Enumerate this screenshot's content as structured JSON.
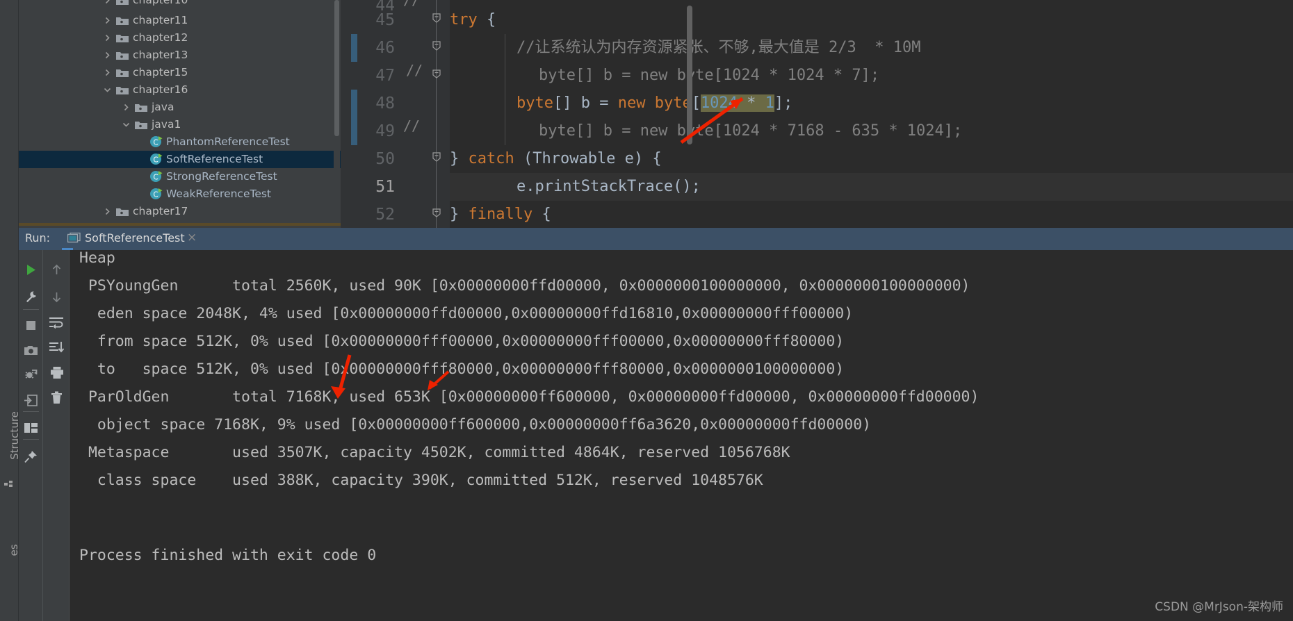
{
  "project_tree": {
    "items": [
      {
        "label": "chapter10",
        "depth": 2,
        "type": "folder",
        "expand": "collapsed",
        "selected": false
      },
      {
        "label": "chapter11",
        "depth": 2,
        "type": "folder",
        "expand": "collapsed",
        "selected": false
      },
      {
        "label": "chapter12",
        "depth": 2,
        "type": "folder",
        "expand": "collapsed",
        "selected": false
      },
      {
        "label": "chapter13",
        "depth": 2,
        "type": "folder",
        "expand": "collapsed",
        "selected": false
      },
      {
        "label": "chapter15",
        "depth": 2,
        "type": "folder",
        "expand": "collapsed",
        "selected": false
      },
      {
        "label": "chapter16",
        "depth": 2,
        "type": "folder",
        "expand": "expanded",
        "selected": false
      },
      {
        "label": "java",
        "depth": 3,
        "type": "folder",
        "expand": "collapsed",
        "selected": false
      },
      {
        "label": "java1",
        "depth": 3,
        "type": "folder",
        "expand": "expanded",
        "selected": false
      },
      {
        "label": "PhantomReferenceTest",
        "depth": 4,
        "type": "class",
        "expand": "none",
        "selected": false
      },
      {
        "label": "SoftReferenceTest",
        "depth": 4,
        "type": "class",
        "expand": "none",
        "selected": true
      },
      {
        "label": "StrongReferenceTest",
        "depth": 4,
        "type": "class",
        "expand": "none",
        "selected": false
      },
      {
        "label": "WeakReferenceTest",
        "depth": 4,
        "type": "class",
        "expand": "none",
        "selected": false
      },
      {
        "label": "chapter17",
        "depth": 2,
        "type": "folder",
        "expand": "collapsed",
        "selected": false
      }
    ]
  },
  "editor": {
    "line_numbers": [
      "44",
      "45",
      "46",
      "47",
      "48",
      "49",
      "50",
      "51",
      "52"
    ],
    "current_line": "51",
    "lines": [
      {
        "number": "45",
        "segments": [
          {
            "t": "        ",
            "c": "plain"
          },
          {
            "t": "try",
            "c": "kw"
          },
          {
            "t": " {",
            "c": "plain"
          }
        ]
      },
      {
        "number": "46",
        "segments": [
          {
            "t": "            //让系统认为内存资源紧张、不够,最大值是 2/3  * 10M",
            "c": "cmt"
          }
        ]
      },
      {
        "number": "47",
        "segments": [
          {
            "t": "              byte[] b = new byte[1024 * 1024 * 7];",
            "c": "cmt"
          }
        ]
      },
      {
        "number": "48",
        "segments": [
          {
            "t": "            ",
            "c": "plain"
          },
          {
            "t": "byte",
            "c": "kw"
          },
          {
            "t": "[] b = ",
            "c": "plain"
          },
          {
            "t": "new",
            "c": "kw"
          },
          {
            "t": " ",
            "c": "plain"
          },
          {
            "t": "byte",
            "c": "kw"
          },
          {
            "t": "[",
            "c": "plain"
          },
          {
            "t": "1024",
            "c": "num-hl"
          },
          {
            "t": " * ",
            "c": "plain-hl"
          },
          {
            "t": "1",
            "c": "num-hl"
          },
          {
            "t": "];",
            "c": "plain"
          }
        ]
      },
      {
        "number": "49",
        "segments": [
          {
            "t": "              byte[] b = new byte[1024 * 7168 - 635 * 1024];",
            "c": "cmt"
          }
        ]
      },
      {
        "number": "50",
        "segments": [
          {
            "t": "        } ",
            "c": "plain"
          },
          {
            "t": "catch",
            "c": "kw"
          },
          {
            "t": " (Throwable e) {",
            "c": "plain"
          }
        ]
      },
      {
        "number": "51",
        "segments": [
          {
            "t": "            e.printStackTrace();",
            "c": "plain"
          }
        ]
      },
      {
        "number": "52",
        "segments": [
          {
            "t": "        } ",
            "c": "plain"
          },
          {
            "t": "finally",
            "c": "kw"
          },
          {
            "t": " {",
            "c": "plain"
          }
        ]
      }
    ],
    "fold_comment_47": "//",
    "fold_comment_49": "//",
    "top_partial": "//"
  },
  "run_panel": {
    "label": "Run:",
    "tab_title": "SoftReferenceTest",
    "close_symbol": "×",
    "toolbar_left": [
      {
        "name": "rerun-icon",
        "glyph": "play"
      },
      {
        "name": "settings-wrench-icon",
        "glyph": "wrench"
      },
      {
        "name": "stop-icon",
        "glyph": "stop"
      },
      {
        "name": "camera-icon",
        "glyph": "camera"
      },
      {
        "name": "debug-restart-icon",
        "glyph": "bug"
      },
      {
        "name": "export-icon",
        "glyph": "export"
      },
      {
        "name": "layout-icon",
        "glyph": "layout"
      },
      {
        "name": "pin-icon",
        "glyph": "pin"
      }
    ],
    "toolbar_right": [
      {
        "name": "up-arrow-icon",
        "glyph": "up"
      },
      {
        "name": "down-arrow-icon",
        "glyph": "down"
      },
      {
        "name": "soft-wrap-icon",
        "glyph": "wrap"
      },
      {
        "name": "scroll-to-end-icon",
        "glyph": "scrollend"
      },
      {
        "name": "print-icon",
        "glyph": "print"
      },
      {
        "name": "clear-all-icon",
        "glyph": "trash"
      }
    ]
  },
  "console": {
    "lines": [
      "Heap",
      " PSYoungGen      total 2560K, used 90K [0x00000000ffd00000, 0x0000000100000000, 0x0000000100000000)",
      "  eden space 2048K, 4% used [0x00000000ffd00000,0x00000000ffd16810,0x00000000fff00000)",
      "  from space 512K, 0% used [0x00000000fff00000,0x00000000fff00000,0x00000000fff80000)",
      "  to   space 512K, 0% used [0x00000000fff80000,0x00000000fff80000,0x0000000100000000)",
      " ParOldGen       total 7168K, used 653K [0x00000000ff600000, 0x00000000ffd00000, 0x00000000ffd00000)",
      "  object space 7168K, 9% used [0x00000000ff600000,0x00000000ff6a3620,0x00000000ffd00000)",
      " Metaspace       used 3507K, capacity 4502K, committed 4864K, reserved 1056768K",
      "  class space    used 388K, capacity 390K, committed 512K, reserved 1048576K",
      "",
      "",
      "Process finished with exit code 0"
    ]
  },
  "sidebar": {
    "structure_label": "Structure",
    "favorites_label": "es"
  },
  "watermark": {
    "text": "CSDN @MrJson-架构师"
  },
  "colors": {
    "editor_bg": "#2b2b2b",
    "panel_bg": "#3c3f41",
    "gutter_bg": "#313335",
    "selection_blue": "#0d293e",
    "tab_header_blue": "#3c5066",
    "accent_blue": "#4a88c7",
    "keyword_orange": "#cc7832",
    "comment_gray": "#808080",
    "number_blue": "#6897bb",
    "text_main": "#a9b7c6",
    "highlight_olive": "#6b6a45",
    "arrow_red": "#ee2200",
    "changebar_blue": "#375e7b"
  }
}
